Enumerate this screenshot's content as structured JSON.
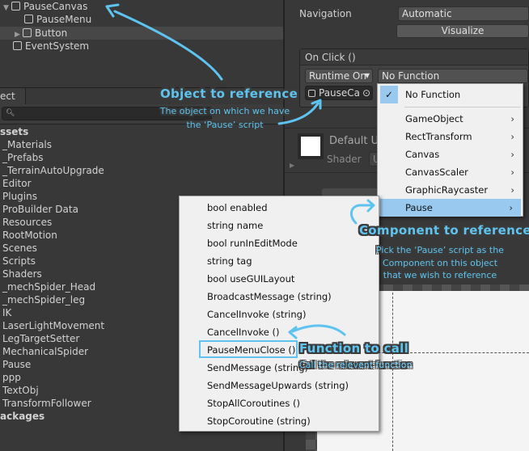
{
  "hierarchy": {
    "items": [
      {
        "label": "PauseCanvas",
        "expanded": "down"
      },
      {
        "label": "PauseMenu"
      },
      {
        "label": "Button",
        "expanded": "right",
        "selected": true
      },
      {
        "label": "EventSystem"
      }
    ]
  },
  "project": {
    "tab_label": "ect",
    "search_icon": "search-icon",
    "items": [
      {
        "label": "ssets",
        "bold": true
      },
      {
        "label": "_Materials"
      },
      {
        "label": "_Prefabs"
      },
      {
        "label": "_TerrainAutoUpgrade"
      },
      {
        "label": "Editor"
      },
      {
        "label": "Plugins"
      },
      {
        "label": "ProBuilder Data"
      },
      {
        "label": "Resources"
      },
      {
        "label": "RootMotion"
      },
      {
        "label": "Scenes"
      },
      {
        "label": "Scripts"
      },
      {
        "label": "Shaders"
      },
      {
        "label": "_mechSpider_Head"
      },
      {
        "label": "_mechSpider_leg"
      },
      {
        "label": "IK"
      },
      {
        "label": "LaserLightMovement"
      },
      {
        "label": "LegTargetSetter"
      },
      {
        "label": "MechanicalSpider"
      },
      {
        "label": "Pause"
      },
      {
        "label": "ppp"
      },
      {
        "label": "TextObj"
      },
      {
        "label": "TransformFollower"
      },
      {
        "label": "ackages",
        "bold": true
      }
    ]
  },
  "inspector": {
    "navigation_label": "Navigation",
    "navigation_value": "Automatic",
    "visualize_label": "Visualize",
    "onclick_header": "On Click ()",
    "runtime_value": "Runtime On",
    "function_value": "No Function",
    "object_value": "PauseCa",
    "material_name": "Default U",
    "shader_label": "Shader",
    "shader_value": "U"
  },
  "component_menu": {
    "items": [
      {
        "label": "No Function",
        "checked": true
      },
      {
        "label": "GameObject",
        "submenu": true
      },
      {
        "label": "RectTransform",
        "submenu": true
      },
      {
        "label": "Canvas",
        "submenu": true
      },
      {
        "label": "CanvasScaler",
        "submenu": true
      },
      {
        "label": "GraphicRaycaster",
        "submenu": true
      },
      {
        "label": "Pause",
        "submenu": true,
        "highlighted": true
      }
    ]
  },
  "function_menu": {
    "items": [
      "bool enabled",
      "string name",
      "bool runInEditMode",
      "string tag",
      "bool useGUILayout",
      "BroadcastMessage (string)",
      "CancelInvoke (string)",
      "CancelInvoke ()",
      "PauseMenuClose ()",
      "SendMessage (string)",
      "SendMessageUpwards (string)",
      "StopAllCoroutines ()",
      "StopCoroutine (string)"
    ],
    "outlined_item": "PauseMenuClose ()"
  },
  "annotations": {
    "object_title": "Object to reference",
    "object_sub1": "The object on which we have",
    "object_sub2": "the ‘Pause’ script",
    "component_title": "Component to reference",
    "component_sub1": "Pick the ‘Pause’ script as the",
    "component_sub2": "Component on this object",
    "component_sub3": "that we wish to reference",
    "function_title": "Function to call",
    "function_sub": "Call the relevent function"
  },
  "colors": {
    "annotation": "#5ec4ef",
    "highlight": "#99c9ef",
    "menu_bg": "#f0f0f0",
    "editor_bg": "#383838"
  }
}
